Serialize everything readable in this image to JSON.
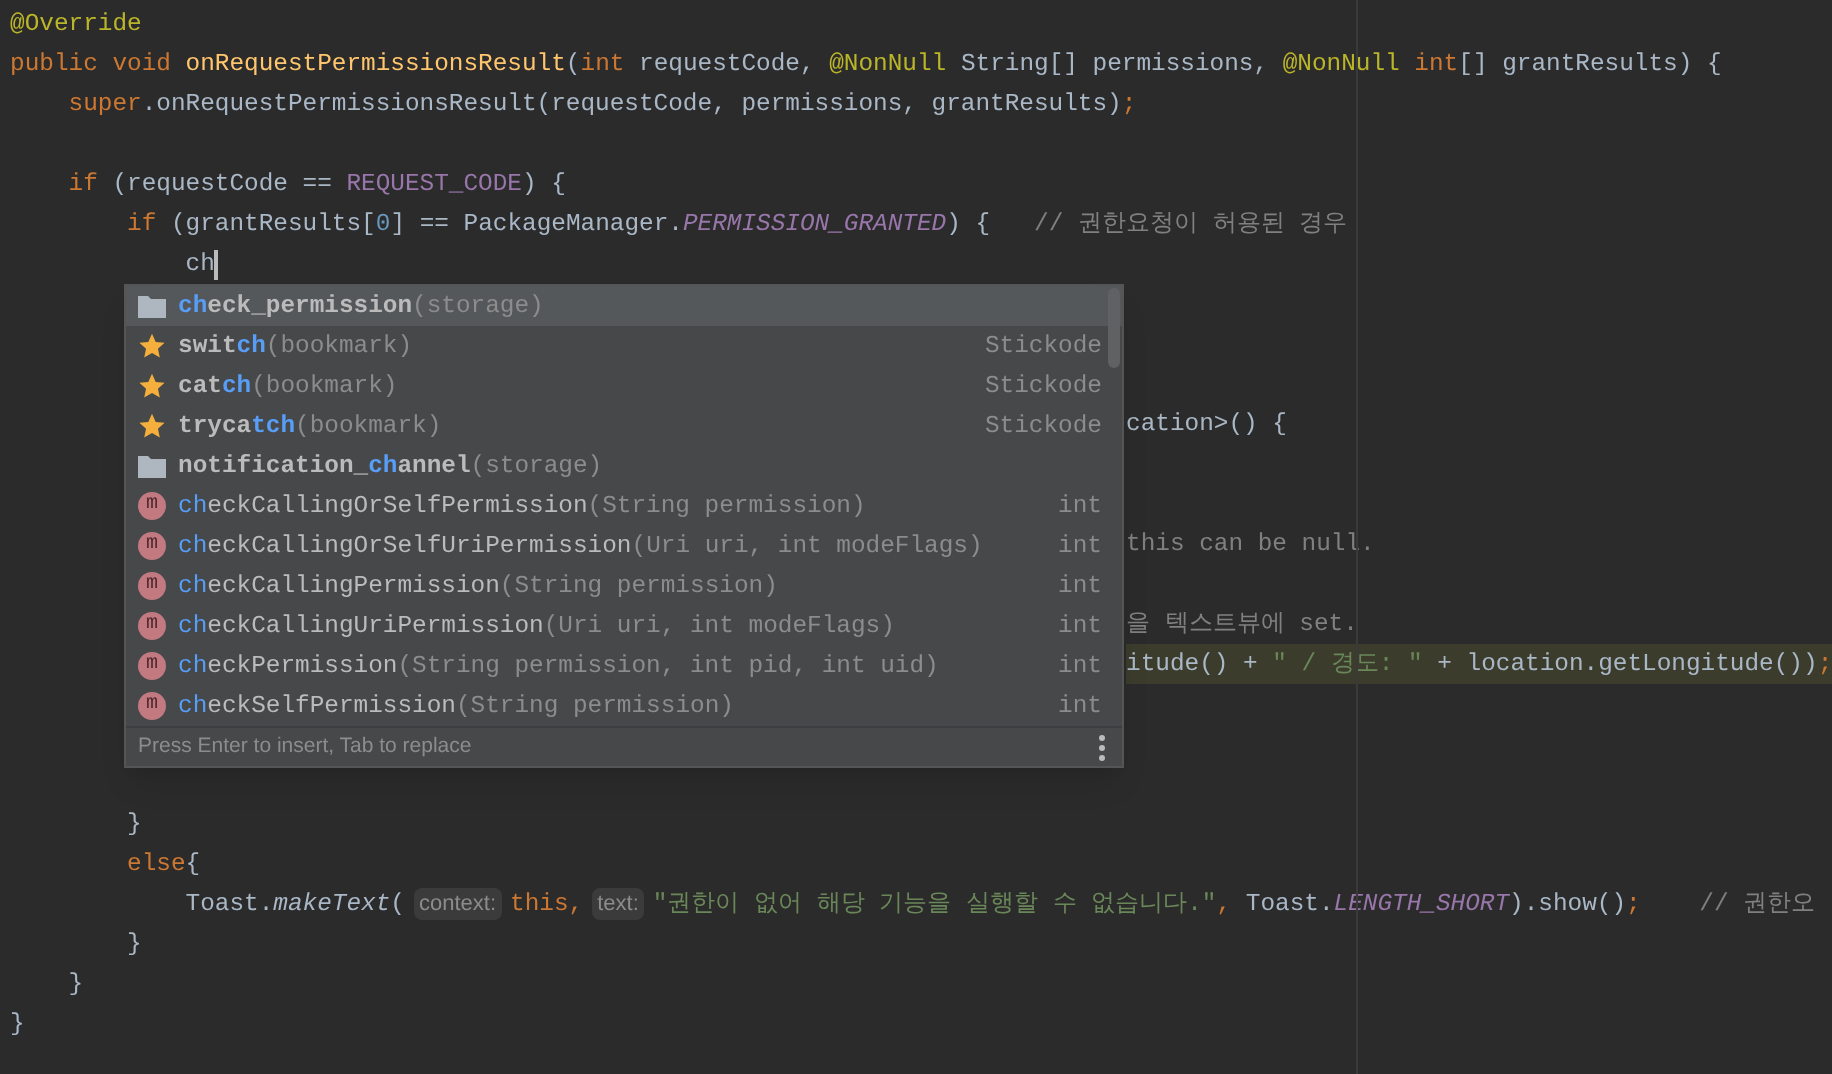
{
  "editor": {
    "lines": [
      {
        "kind": "full",
        "segments": [
          {
            "kind": "annotation",
            "text": "@Override"
          }
        ]
      },
      {
        "kind": "full",
        "segments": [
          {
            "kind": "keyword",
            "text": "public void "
          },
          {
            "kind": "method",
            "text": "onRequestPermissionsResult"
          },
          {
            "kind": "plain",
            "text": "("
          },
          {
            "kind": "keyword",
            "text": "int"
          },
          {
            "kind": "plain",
            "text": " requestCode, "
          },
          {
            "kind": "annotation",
            "text": "@NonNull"
          },
          {
            "kind": "plain",
            "text": " String[] permissions, "
          },
          {
            "kind": "annotation",
            "text": "@NonNull"
          },
          {
            "kind": "keyword",
            "text": " int"
          },
          {
            "kind": "plain",
            "text": "[] grantResults) {"
          }
        ]
      },
      {
        "kind": "full",
        "segments": [
          {
            "kind": "keyword",
            "text": "    super"
          },
          {
            "kind": "plain",
            "text": ".onRequestPermissionsResult(requestCode, permissions, grantResults)"
          },
          {
            "kind": "keyword",
            "text": ";"
          }
        ]
      },
      {
        "kind": "blank"
      },
      {
        "kind": "full",
        "segments": [
          {
            "kind": "keyword",
            "text": "    if"
          },
          {
            "kind": "plain",
            "text": " (requestCode == "
          },
          {
            "kind": "constant",
            "text": "REQUEST_CODE"
          },
          {
            "kind": "plain",
            "text": ") {"
          }
        ]
      },
      {
        "kind": "full",
        "segments": [
          {
            "kind": "keyword",
            "text": "        if"
          },
          {
            "kind": "plain",
            "text": " (grantResults["
          },
          {
            "kind": "number",
            "text": "0"
          },
          {
            "kind": "plain",
            "text": "] == PackageManager."
          },
          {
            "kind": "constant_italic",
            "text": "PERMISSION_GRANTED"
          },
          {
            "kind": "plain",
            "text": ") {   "
          },
          {
            "kind": "comment",
            "text": "// 권한요청이 허용된 경우"
          }
        ]
      },
      {
        "kind": "full",
        "caret": true,
        "segments": [
          {
            "kind": "plain",
            "text": "            ch"
          }
        ]
      },
      {
        "kind": "blank"
      },
      {
        "kind": "blank"
      },
      {
        "kind": "blank"
      },
      {
        "kind": "partial",
        "segments": [
          {
            "kind": "plain",
            "text": "cation>() {"
          }
        ]
      },
      {
        "kind": "blank"
      },
      {
        "kind": "blank"
      },
      {
        "kind": "partial",
        "segments": [
          {
            "kind": "comment",
            "text": "this can be null."
          }
        ]
      },
      {
        "kind": "blank"
      },
      {
        "kind": "partial",
        "segments": [
          {
            "kind": "comment",
            "text": "을 텍스트뷰에 set."
          }
        ]
      },
      {
        "kind": "partial",
        "highlighted": true,
        "segments": [
          {
            "kind": "plain",
            "text": "itude() + "
          },
          {
            "kind": "string",
            "text": "\" / 경도: \""
          },
          {
            "kind": "plain",
            "text": " + location.getLongitude())"
          },
          {
            "kind": "keyword",
            "text": ";"
          }
        ]
      },
      {
        "kind": "blank"
      },
      {
        "kind": "blank"
      },
      {
        "kind": "blank"
      },
      {
        "kind": "full",
        "segments": [
          {
            "kind": "plain",
            "text": "        }"
          }
        ]
      },
      {
        "kind": "full",
        "segments": [
          {
            "kind": "keyword",
            "text": "        else"
          },
          {
            "kind": "plain",
            "text": "{"
          }
        ]
      },
      {
        "kind": "full",
        "segments": [
          {
            "kind": "plain",
            "text": "            Toast."
          },
          {
            "kind": "static_italic",
            "text": "makeText"
          },
          {
            "kind": "plain",
            "text": "("
          },
          {
            "kind": "hint",
            "text": "context:"
          },
          {
            "kind": "keyword",
            "text": "this,"
          },
          {
            "kind": "hint",
            "text": "text:"
          },
          {
            "kind": "string",
            "text": "\"권한이 없어 해당 기능을 실행할 수 없습니다.\""
          },
          {
            "kind": "keyword",
            "text": ", "
          },
          {
            "kind": "plain",
            "text": "Toast."
          },
          {
            "kind": "constant_italic",
            "text": "LENGTH_SHORT"
          },
          {
            "kind": "plain",
            "text": ").show()"
          },
          {
            "kind": "keyword",
            "text": ";"
          },
          {
            "kind": "comment",
            "text": "    // 권한오"
          }
        ]
      },
      {
        "kind": "full",
        "segments": [
          {
            "kind": "plain",
            "text": "        }"
          }
        ]
      },
      {
        "kind": "full",
        "segments": [
          {
            "kind": "plain",
            "text": "    }"
          }
        ]
      },
      {
        "kind": "full",
        "segments": [
          {
            "kind": "plain",
            "text": "}"
          }
        ]
      }
    ]
  },
  "completion": {
    "items": [
      {
        "kind": "storage",
        "selected": true,
        "name_parts": [
          {
            "text": "ch",
            "matched": true
          },
          {
            "text": "eck_permission",
            "matched": false
          }
        ],
        "params": "(storage)"
      },
      {
        "kind": "bookmark",
        "selected": false,
        "name_parts": [
          {
            "text": "swit",
            "matched": false
          },
          {
            "text": "ch",
            "matched": true
          }
        ],
        "params": "(bookmark)",
        "type": "Stickode"
      },
      {
        "kind": "bookmark",
        "selected": false,
        "name_parts": [
          {
            "text": "cat",
            "matched": false
          },
          {
            "text": "ch",
            "matched": true
          }
        ],
        "params": "(bookmark)",
        "type": "Stickode"
      },
      {
        "kind": "bookmark",
        "selected": false,
        "name_parts": [
          {
            "text": "tryca",
            "matched": false
          },
          {
            "text": "tch",
            "matched": true
          }
        ],
        "params": "(bookmark)",
        "type": "Stickode"
      },
      {
        "kind": "storage",
        "selected": false,
        "name_parts": [
          {
            "text": "notification_",
            "matched": false
          },
          {
            "text": "ch",
            "matched": true
          },
          {
            "text": "annel",
            "matched": false
          }
        ],
        "params": "(storage)"
      },
      {
        "kind": "method",
        "badge": "m",
        "selected": false,
        "name_parts": [
          {
            "text": "ch",
            "matched": true
          },
          {
            "text": "eckCallingOrSelfPermission",
            "matched": false
          }
        ],
        "params": "(String permission)",
        "type": "int"
      },
      {
        "kind": "method",
        "badge": "m",
        "selected": false,
        "name_parts": [
          {
            "text": "ch",
            "matched": true
          },
          {
            "text": "eckCallingOrSelfUriPermission",
            "matched": false
          }
        ],
        "params": "(Uri uri, int modeFlags)",
        "type": "int"
      },
      {
        "kind": "method",
        "badge": "m",
        "selected": false,
        "name_parts": [
          {
            "text": "ch",
            "matched": true
          },
          {
            "text": "eckCallingPermission",
            "matched": false
          }
        ],
        "params": "(String permission)",
        "type": "int"
      },
      {
        "kind": "method",
        "badge": "m",
        "selected": false,
        "name_parts": [
          {
            "text": "ch",
            "matched": true
          },
          {
            "text": "eckCallingUriPermission",
            "matched": false
          }
        ],
        "params": "(Uri uri, int modeFlags)",
        "type": "int"
      },
      {
        "kind": "method",
        "badge": "m",
        "selected": false,
        "name_parts": [
          {
            "text": "ch",
            "matched": true
          },
          {
            "text": "eckPermission",
            "matched": false
          }
        ],
        "params": "(String permission, int pid, int uid)",
        "type": "int"
      },
      {
        "kind": "method",
        "badge": "m",
        "selected": false,
        "name_parts": [
          {
            "text": "ch",
            "matched": true
          },
          {
            "text": "eckSelfPermission",
            "matched": false
          }
        ],
        "params": "(String permission)",
        "type": "int"
      }
    ],
    "footer": "Press Enter to insert, Tab to replace"
  }
}
